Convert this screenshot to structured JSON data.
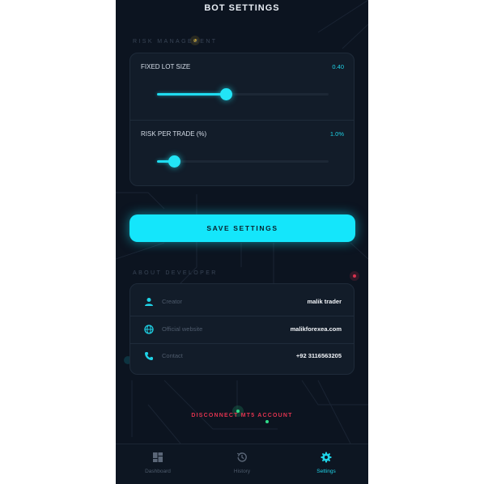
{
  "header": {
    "title": "BOT SETTINGS"
  },
  "risk": {
    "section_label": "RISK MANAGEMENT",
    "lot": {
      "label": "FIXED LOT SIZE",
      "value": "0.40",
      "fraction": 0.4
    },
    "risk_per_trade": {
      "label": "RISK PER TRADE (%)",
      "value": "1.0%",
      "fraction": 0.1
    }
  },
  "save_button": {
    "label": "SAVE SETTINGS"
  },
  "developer": {
    "section_label": "ABOUT DEVELOPER",
    "rows": [
      {
        "icon": "person-icon",
        "label": "Creator",
        "value": "malik trader"
      },
      {
        "icon": "globe-icon",
        "label": "Official website",
        "value": "malikforexea.com"
      },
      {
        "icon": "phone-icon",
        "label": "Contact",
        "value": "+92 3116563205"
      }
    ]
  },
  "disconnect": {
    "label": "DISCONNECT MT5 ACCOUNT"
  },
  "nav": {
    "items": [
      {
        "icon": "dashboard-icon",
        "label": "Dashboard",
        "active": false
      },
      {
        "icon": "history-icon",
        "label": "History",
        "active": false
      },
      {
        "icon": "gear-icon",
        "label": "Settings",
        "active": true
      }
    ]
  },
  "colors": {
    "accent": "#14e6fb",
    "danger": "#e0334f",
    "background": "#0c1420",
    "card": "#121c29"
  }
}
